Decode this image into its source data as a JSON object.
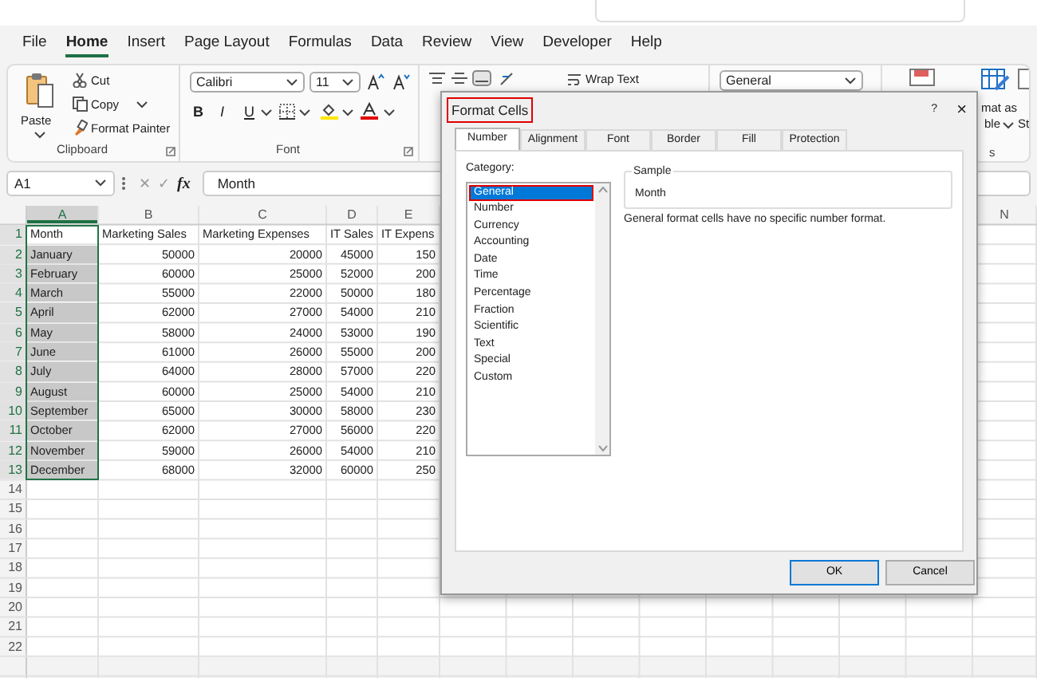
{
  "menu_tabs": [
    {
      "label": "File",
      "selected": false
    },
    {
      "label": "Home",
      "selected": true
    },
    {
      "label": "Insert",
      "selected": false
    },
    {
      "label": "Page Layout",
      "selected": false
    },
    {
      "label": "Formulas",
      "selected": false
    },
    {
      "label": "Data",
      "selected": false
    },
    {
      "label": "Review",
      "selected": false
    },
    {
      "label": "View",
      "selected": false
    },
    {
      "label": "Developer",
      "selected": false
    },
    {
      "label": "Help",
      "selected": false
    }
  ],
  "ribbon": {
    "clipboard": {
      "paste": "Paste",
      "cut": "Cut",
      "copy": "Copy",
      "format_painter": "Format Painter",
      "label": "Clipboard"
    },
    "font": {
      "font_name": "Calibri",
      "font_size": "11",
      "bold": "B",
      "italic": "I",
      "underline": "U",
      "label": "Font"
    },
    "alignment": {
      "wrap_text": "Wrap Text"
    },
    "number": {
      "format": "General"
    },
    "styles": {
      "format_as_table_line_1": "mat as",
      "format_as_table_line_2": "ble",
      "cell_styles": "St",
      "label": "s"
    }
  },
  "formula_bar": {
    "name_box": "A1",
    "cancel": "✕",
    "enter": "✓",
    "function": "fx",
    "value": "Month"
  },
  "sheet": {
    "columns": [
      {
        "label": "A",
        "selected": true
      },
      {
        "label": "B",
        "selected": false
      },
      {
        "label": "C",
        "selected": false
      },
      {
        "label": "D",
        "selected": false
      },
      {
        "label": "E",
        "selected": false
      },
      {
        "label": "N",
        "selected": false
      }
    ],
    "rows": [
      [
        "Month",
        "Marketing Sales",
        "Marketing Expenses",
        "IT Sales",
        "IT Expens"
      ],
      [
        "January",
        "50000",
        "20000",
        "45000",
        "150"
      ],
      [
        "February",
        "60000",
        "25000",
        "52000",
        "200"
      ],
      [
        "March",
        "55000",
        "22000",
        "50000",
        "180"
      ],
      [
        "April",
        "62000",
        "27000",
        "54000",
        "210"
      ],
      [
        "May",
        "58000",
        "24000",
        "53000",
        "190"
      ],
      [
        "June",
        "61000",
        "26000",
        "55000",
        "200"
      ],
      [
        "July",
        "64000",
        "28000",
        "57000",
        "220"
      ],
      [
        "August",
        "60000",
        "25000",
        "54000",
        "210"
      ],
      [
        "September",
        "65000",
        "30000",
        "58000",
        "230"
      ],
      [
        "October",
        "62000",
        "27000",
        "56000",
        "220"
      ],
      [
        "November",
        "59000",
        "26000",
        "54000",
        "210"
      ],
      [
        "December",
        "68000",
        "32000",
        "60000",
        "250"
      ]
    ],
    "row_numbers": [
      "1",
      "2",
      "3",
      "4",
      "5",
      "6",
      "7",
      "8",
      "9",
      "10",
      "11",
      "12",
      "13",
      "14",
      "15",
      "16",
      "17",
      "18",
      "19",
      "20",
      "21",
      "22"
    ]
  },
  "dialog": {
    "title": {
      "text": "Format Cells",
      "highlighted": true
    },
    "help": "?",
    "close": "×",
    "tabs": [
      {
        "label": "Number",
        "selected": true
      },
      {
        "label": "Alignment",
        "selected": false
      },
      {
        "label": "Font",
        "selected": false
      },
      {
        "label": "Border",
        "selected": false
      },
      {
        "label": "Fill",
        "selected": false
      },
      {
        "label": "Protection",
        "selected": false
      }
    ],
    "category_label": "Category:",
    "categories": [
      {
        "label": "General",
        "selected": true,
        "highlighted": true
      },
      {
        "label": "Number",
        "selected": false,
        "highlighted": false
      },
      {
        "label": "Currency",
        "selected": false,
        "highlighted": false
      },
      {
        "label": "Accounting",
        "selected": false,
        "highlighted": false
      },
      {
        "label": "Date",
        "selected": false,
        "highlighted": false
      },
      {
        "label": "Time",
        "selected": false,
        "highlighted": false
      },
      {
        "label": "Percentage",
        "selected": false,
        "highlighted": false
      },
      {
        "label": "Fraction",
        "selected": false,
        "highlighted": false
      },
      {
        "label": "Scientific",
        "selected": false,
        "highlighted": false
      },
      {
        "label": "Text",
        "selected": false,
        "highlighted": false
      },
      {
        "label": "Special",
        "selected": false,
        "highlighted": false
      },
      {
        "label": "Custom",
        "selected": false,
        "highlighted": false
      }
    ],
    "sample_label": "Sample",
    "sample_value": "Month",
    "description": "General format cells have no specific number format.",
    "buttons": [
      {
        "label": "OK",
        "kind": "primary"
      },
      {
        "label": "Cancel",
        "kind": "secondary"
      }
    ]
  }
}
